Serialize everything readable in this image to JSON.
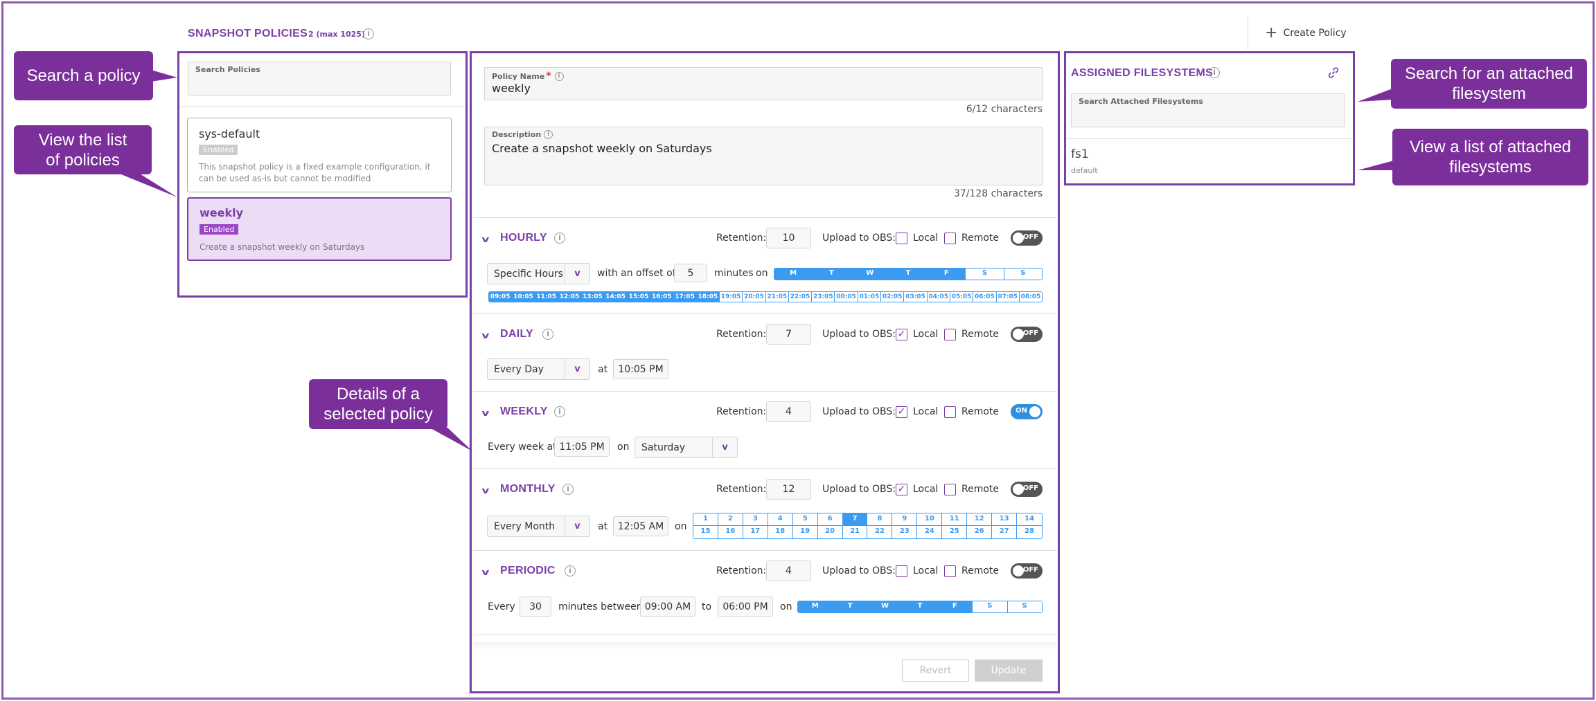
{
  "header": {
    "title": "SNAPSHOT POLICIES",
    "count": "2 (max 1025)",
    "create_label": "Create Policy"
  },
  "callouts": {
    "search": "Search a policy",
    "list": "View the list of policies",
    "details": "Details of a selected policy",
    "search_fs": "Search for an attached filesystem",
    "list_fs": "View a list of attached filesystems"
  },
  "policy_list": {
    "search_label": "Search Policies",
    "search_value": "",
    "items": [
      {
        "name": "sys-default",
        "status": "Enabled",
        "description": "This snapshot policy is a fixed example configuration, it can be used as-is but cannot be modified"
      },
      {
        "name": "weekly",
        "status": "Enabled",
        "description": "Create a snapshot weekly on Saturdays"
      }
    ]
  },
  "details": {
    "name_label": "Policy Name",
    "name_value": "weekly",
    "name_count": "6/12 characters",
    "desc_label": "Description",
    "desc_value": "Create a snapshot weekly on Saturdays",
    "desc_count": "37/128 characters",
    "common": {
      "retention_label": "Retention:",
      "upload_label": "Upload to OBS:",
      "local_label": "Local",
      "remote_label": "Remote",
      "on_label": "ON",
      "off_label": "OFF"
    },
    "hourly": {
      "title": "HOURLY",
      "retention": "10",
      "local": false,
      "remote": false,
      "enabled": false,
      "mode": "Specific Hours",
      "offset_label": "with an offset of",
      "offset": "5",
      "minutes_label": "minutes",
      "on_label": "on",
      "days": [
        {
          "label": "M",
          "on": true
        },
        {
          "label": "T",
          "on": true
        },
        {
          "label": "W",
          "on": true
        },
        {
          "label": "T",
          "on": true
        },
        {
          "label": "F",
          "on": true
        },
        {
          "label": "S",
          "on": false
        },
        {
          "label": "S",
          "on": false
        }
      ],
      "hours": [
        {
          "label": "09:05",
          "on": true
        },
        {
          "label": "10:05",
          "on": true
        },
        {
          "label": "11:05",
          "on": true
        },
        {
          "label": "12:05",
          "on": true
        },
        {
          "label": "13:05",
          "on": true
        },
        {
          "label": "14:05",
          "on": true
        },
        {
          "label": "15:05",
          "on": true
        },
        {
          "label": "16:05",
          "on": true
        },
        {
          "label": "17:05",
          "on": true
        },
        {
          "label": "18:05",
          "on": true
        },
        {
          "label": "19:05",
          "on": false
        },
        {
          "label": "20:05",
          "on": false
        },
        {
          "label": "21:05",
          "on": false
        },
        {
          "label": "22:05",
          "on": false
        },
        {
          "label": "23:05",
          "on": false
        },
        {
          "label": "00:05",
          "on": false
        },
        {
          "label": "01:05",
          "on": false
        },
        {
          "label": "02:05",
          "on": false
        },
        {
          "label": "03:05",
          "on": false
        },
        {
          "label": "04:05",
          "on": false
        },
        {
          "label": "05:05",
          "on": false
        },
        {
          "label": "06:05",
          "on": false
        },
        {
          "label": "07:05",
          "on": false
        },
        {
          "label": "08:05",
          "on": false
        }
      ]
    },
    "daily": {
      "title": "DAILY",
      "retention": "7",
      "local": true,
      "remote": false,
      "enabled": false,
      "mode": "Every Day",
      "at_label": "at",
      "time": "10:05 PM"
    },
    "weekly": {
      "title": "WEEKLY",
      "retention": "4",
      "local": true,
      "remote": false,
      "enabled": true,
      "every_label": "Every week at",
      "time": "11:05 PM",
      "on_label": "on",
      "day": "Saturday"
    },
    "monthly": {
      "title": "MONTHLY",
      "retention": "12",
      "local": true,
      "remote": false,
      "enabled": false,
      "mode": "Every Month",
      "at_label": "at",
      "time": "12:05 AM",
      "on_label": "on",
      "selected_day": 7
    },
    "periodic": {
      "title": "PERIODIC",
      "retention": "4",
      "local": false,
      "remote": false,
      "enabled": false,
      "every_label": "Every",
      "interval": "30",
      "between_label": "minutes between",
      "start": "09:00 AM",
      "to_label": "to",
      "end": "06:00 PM",
      "on_label": "on",
      "days": [
        {
          "label": "M",
          "on": true
        },
        {
          "label": "T",
          "on": true
        },
        {
          "label": "W",
          "on": true
        },
        {
          "label": "T",
          "on": true
        },
        {
          "label": "F",
          "on": true
        },
        {
          "label": "S",
          "on": false
        },
        {
          "label": "S",
          "on": false
        }
      ]
    },
    "revert_label": "Revert",
    "update_label": "Update"
  },
  "filesystems": {
    "title": "ASSIGNED FILESYSTEMS",
    "search_label": "Search Attached Filesystems",
    "items": [
      {
        "name": "fs1",
        "group": "default"
      }
    ]
  },
  "colors": {
    "accent": "#7b3fa8",
    "callout": "#7b2f9a",
    "day_on": "#3a9bf0",
    "toggle_on": "#2d8fe0",
    "toggle_off": "#555555"
  },
  "icons": [
    "info-icon",
    "plus-icon",
    "link-icon",
    "chevron-down-icon",
    "check-icon"
  ]
}
